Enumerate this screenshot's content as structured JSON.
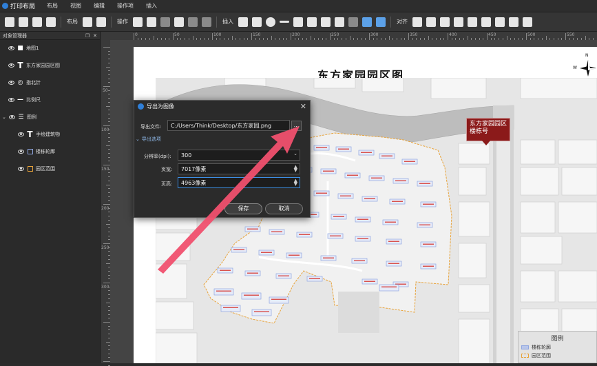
{
  "app": {
    "title": "打印布局"
  },
  "menu": [
    "布局",
    "视图",
    "编辑",
    "操作项",
    "插入"
  ],
  "toolbar": {
    "layout_label": "布局",
    "operate_label": "操作",
    "insert_label": "插入",
    "align_label": "对齐"
  },
  "ruler": {
    "top_numbers": [
      "0",
      "50",
      "100",
      "150",
      "200",
      "250",
      "300",
      "350",
      "400",
      "450",
      "500",
      "550"
    ],
    "left_numbers": [
      "50",
      "100",
      "150",
      "200",
      "250",
      "300"
    ]
  },
  "panel": {
    "title": "对象管理器",
    "layers": [
      {
        "label": "地图1",
        "icon": "map-icon"
      },
      {
        "label": "东方家园园区图",
        "icon": "text-icon"
      },
      {
        "label": "指北针",
        "icon": "compass-icon"
      },
      {
        "label": "比例尺",
        "icon": "scalebar-icon"
      },
      {
        "label": "图例",
        "icon": "legend-icon"
      },
      {
        "label": "手绘建筑物",
        "icon": "text-icon"
      },
      {
        "label": "楼栋轮廓",
        "icon": "polygon-icon"
      },
      {
        "label": "园区范围",
        "icon": "polygon-icon"
      }
    ]
  },
  "page": {
    "title": "东方家园园区图"
  },
  "callout": {
    "line1": "东方家园园区",
    "line2": "楼栋号"
  },
  "compass": {
    "n": "N",
    "w": "W"
  },
  "legend": {
    "title": "图例",
    "items": [
      {
        "label": "楼栋轮廓",
        "color": "#b8c6ea"
      },
      {
        "label": "园区范围",
        "color": "#e8a33a"
      }
    ]
  },
  "dialog": {
    "title": "导出为图像",
    "file_label": "导出文件:",
    "file_value": "C:/Users/Think/Desktop/东方家园.png",
    "browse_label": "...",
    "options_label": "导出选项",
    "dpi_label": "分辨率(dpi):",
    "dpi_value": "300",
    "width_label": "页宽:",
    "width_value": "7017像素",
    "height_label": "页高:",
    "height_value": "4963像素",
    "save_label": "保存",
    "cancel_label": "取消"
  },
  "colors": {
    "accent": "#3d8fe5",
    "boundary": "#e8a33a",
    "building": "#b8c6ea",
    "callout": "#8b1a1a",
    "arrow": "#f0506e"
  }
}
